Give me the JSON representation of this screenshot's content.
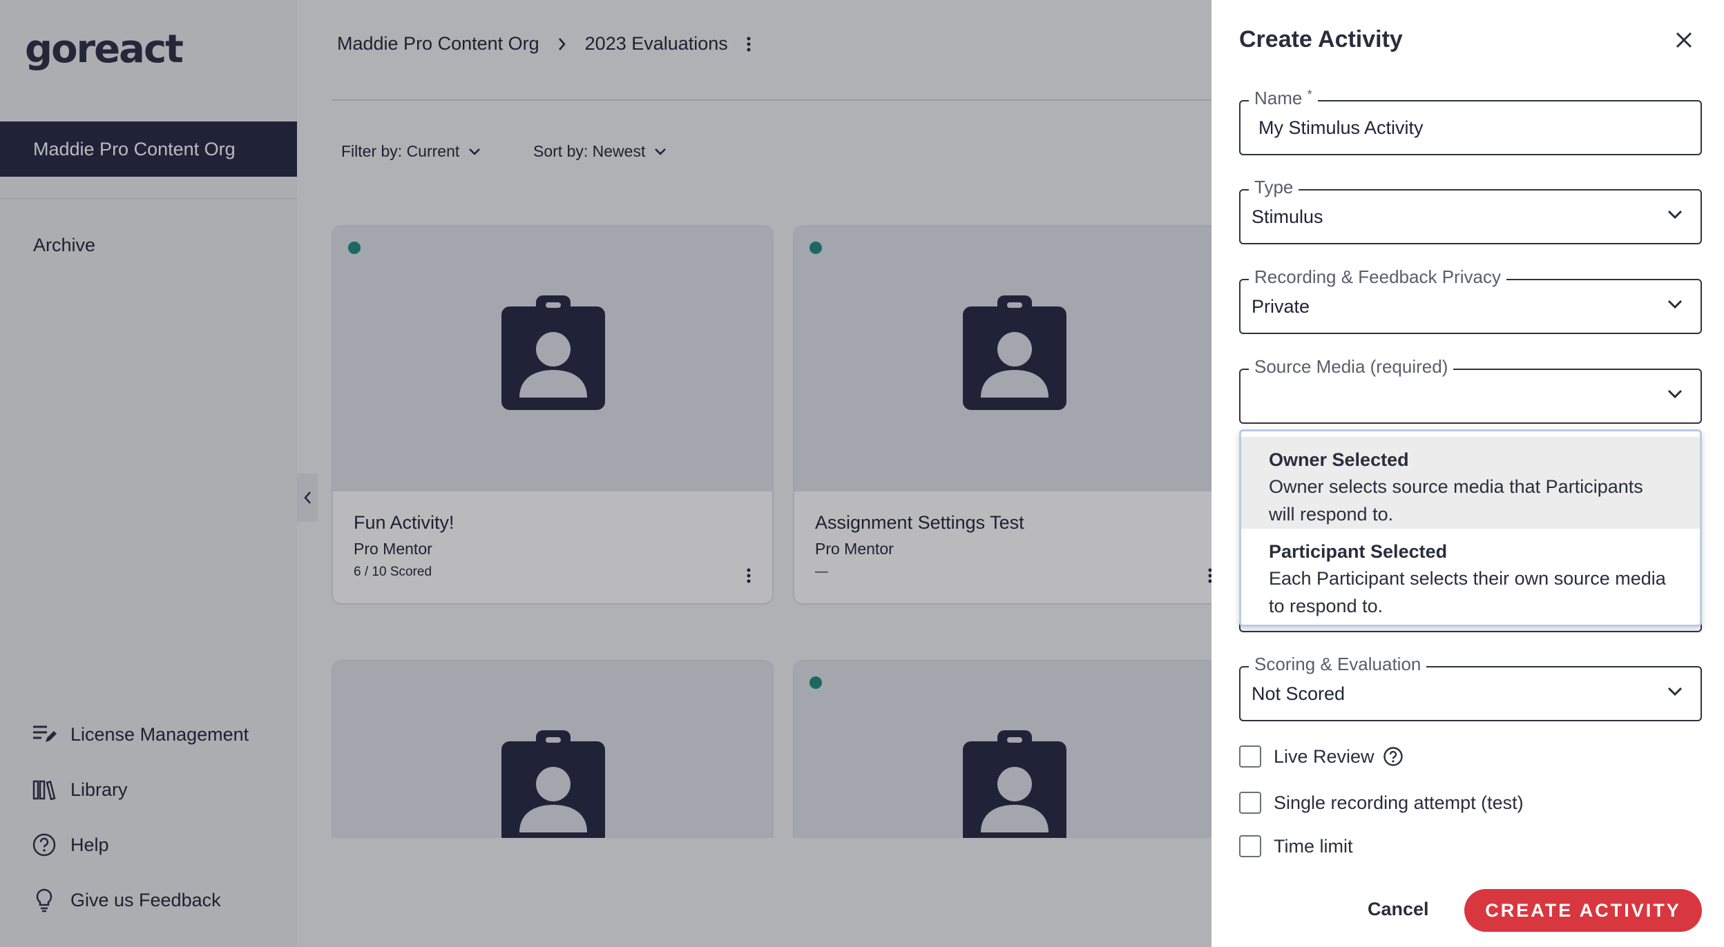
{
  "app": {
    "logo_text": "goreact",
    "brand_colors": {
      "sidebar_active": "#232842",
      "primary_button": "#d9373f",
      "status_dot": "#1f8a7c"
    }
  },
  "sidebar": {
    "org_name": "Maddie Pro Content Org",
    "archive_label": "Archive",
    "bottom_items": [
      {
        "label": "License Management",
        "icon": "edit-list-icon"
      },
      {
        "label": "Library",
        "icon": "books-icon"
      },
      {
        "label": "Help",
        "icon": "help-circle-icon"
      },
      {
        "label": "Give us Feedback",
        "icon": "lightbulb-icon"
      }
    ]
  },
  "header": {
    "breadcrumb": [
      "Maddie Pro Content Org",
      "2023 Evaluations"
    ]
  },
  "filters": {
    "filter_label": "Filter by: Current",
    "sort_label": "Sort by: Newest"
  },
  "cards": [
    {
      "title": "Fun Activity!",
      "subtitle": "Pro Mentor",
      "meta": "6 / 10 Scored"
    },
    {
      "title": "Assignment Settings Test",
      "subtitle": "Pro Mentor",
      "meta": "—"
    },
    {
      "title": "",
      "subtitle": "",
      "meta": ""
    },
    {
      "title": "",
      "subtitle": "",
      "meta": ""
    }
  ],
  "panel": {
    "title": "Create Activity",
    "name_label": "Name",
    "name_value": "My Stimulus Activity",
    "type_label": "Type",
    "type_value": "Stimulus",
    "privacy_label": "Recording & Feedback Privacy",
    "privacy_value": "Private",
    "source_label": "Source Media (required)",
    "source_value": "",
    "source_options": [
      {
        "title": "Owner Selected",
        "description": "Owner selects source media that Participants will respond to."
      },
      {
        "title": "Participant Selected",
        "description": "Each Participant selects their own source media to respond to."
      }
    ],
    "scoring_label": "Scoring & Evaluation",
    "scoring_value": "Not Scored",
    "checkboxes": [
      {
        "label": "Live Review",
        "checked": false
      },
      {
        "label": "Single recording attempt (test)",
        "checked": false
      },
      {
        "label": "Time limit",
        "checked": false
      }
    ],
    "cancel_label": "Cancel",
    "create_label": "CREATE ACTIVITY"
  }
}
